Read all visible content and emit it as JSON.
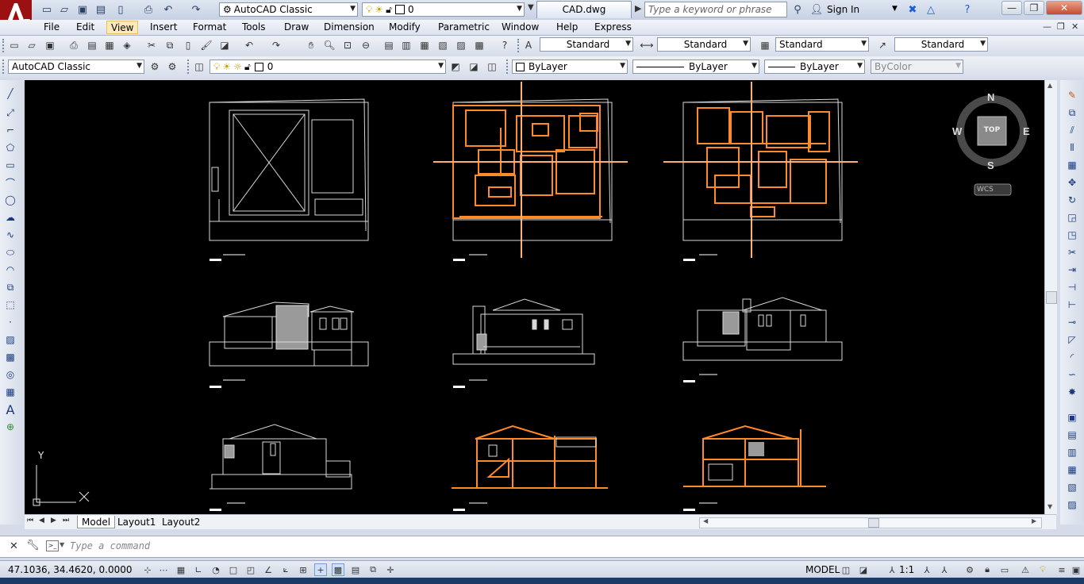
{
  "titlebar": {
    "workspace": "AutoCAD Classic",
    "layer": "0",
    "file_tab": "CAD.dwg",
    "search_placeholder": "Type a keyword or phrase",
    "sign_in": "Sign In"
  },
  "menu": [
    {
      "label": "File"
    },
    {
      "label": "Edit"
    },
    {
      "label": "View"
    },
    {
      "label": "Insert"
    },
    {
      "label": "Format"
    },
    {
      "label": "Tools"
    },
    {
      "label": "Draw"
    },
    {
      "label": "Dimension"
    },
    {
      "label": "Modify"
    },
    {
      "label": "Parametric"
    },
    {
      "label": "Window"
    },
    {
      "label": "Help"
    },
    {
      "label": "Express"
    }
  ],
  "active_menu": "View",
  "styles": {
    "text_style": "Standard",
    "dim_style": "Standard",
    "table_style": "Standard",
    "mleader_style": "Standard"
  },
  "properties": {
    "workspace": "AutoCAD Classic",
    "layer": "0",
    "color": "ByLayer",
    "linetype": "ByLayer",
    "lineweight": "ByLayer",
    "plotstyle": "ByColor"
  },
  "viewcube": {
    "north": "N",
    "south": "S",
    "east": "E",
    "west": "W",
    "face": "TOP",
    "ucs": "WCS"
  },
  "ucs_icon": {
    "y": "Y"
  },
  "layout_tabs": [
    {
      "label": "Model"
    },
    {
      "label": "Layout1"
    },
    {
      "label": "Layout2"
    }
  ],
  "command_line": {
    "placeholder": "Type a command"
  },
  "status": {
    "coordinates": "47.1036, 34.4620, 0.0000",
    "space": "MODEL",
    "scale": "1:1"
  },
  "colors": {
    "canvas": "#000000",
    "selection": "#ff8a2a",
    "linework": "#d9d9d9",
    "chrome": "#d6dbe9"
  }
}
